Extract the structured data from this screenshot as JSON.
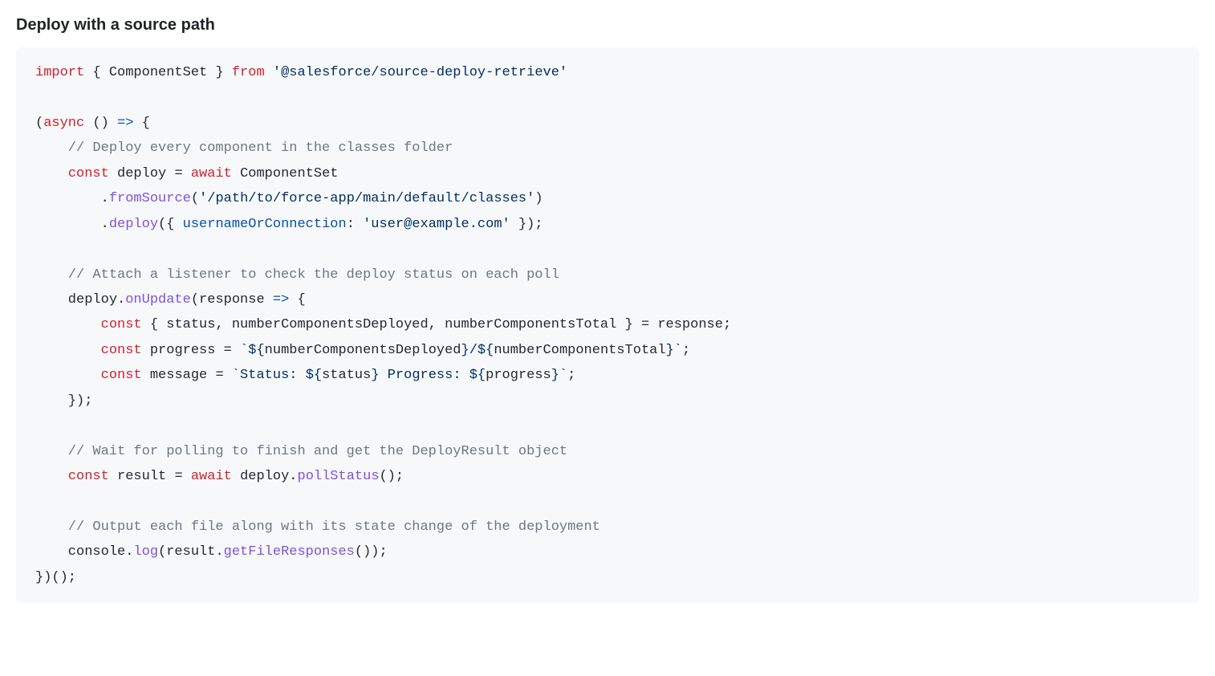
{
  "heading": "Deploy with a source path",
  "code": {
    "l1": {
      "import": "import",
      "left": " { ComponentSet } ",
      "from": "from",
      "str": " '@salesforce/source-deploy-retrieve'"
    },
    "l3": {
      "open": "(",
      "async": "async",
      "rest": " () ",
      "arrow": "=>",
      "brace": " {"
    },
    "l4": {
      "comment": "    // Deploy every component in the classes folder"
    },
    "l5": {
      "indent": "    ",
      "const": "const",
      "mid": " deploy = ",
      "await": "await",
      "rest": " ComponentSet"
    },
    "l6": {
      "indent": "        .",
      "method": "fromSource",
      "open": "(",
      "str": "'/path/to/force-app/main/default/classes'",
      "close": ")"
    },
    "l7": {
      "indent": "        .",
      "method": "deploy",
      "open": "({ ",
      "prop": "usernameOrConnection",
      "colon": ": ",
      "str": "'user@example.com'",
      "close": " });"
    },
    "l9": {
      "comment": "    // Attach a listener to check the deploy status on each poll"
    },
    "l10": {
      "indent": "    deploy.",
      "method": "onUpdate",
      "open": "(response ",
      "arrow": "=>",
      "close": " {"
    },
    "l11": {
      "indent": "        ",
      "const": "const",
      "rest": " { status, numberComponentsDeployed, numberComponentsTotal } = response;"
    },
    "l12": {
      "indent": "        ",
      "const": "const",
      "mid": " progress = ",
      "t1": "`",
      "e1o": "${",
      "e1": "numberComponentsDeployed",
      "e1c": "}",
      "slash": "/",
      "e2o": "${",
      "e2": "numberComponentsTotal",
      "e2c": "}",
      "t2": "`",
      "semi": ";"
    },
    "l13": {
      "indent": "        ",
      "const": "const",
      "mid": " message = ",
      "t1": "`Status: ",
      "e1o": "${",
      "e1": "status",
      "e1c": "}",
      "t2": " Progress: ",
      "e2o": "${",
      "e2": "progress",
      "e2c": "}",
      "t3": "`",
      "semi": ";"
    },
    "l14": {
      "text": "    });"
    },
    "l16": {
      "comment": "    // Wait for polling to finish and get the DeployResult object"
    },
    "l17": {
      "indent": "    ",
      "const": "const",
      "mid": " result = ",
      "await": "await",
      "mid2": " deploy.",
      "method": "pollStatus",
      "close": "();"
    },
    "l19": {
      "comment": "    // Output each file along with its state change of the deployment"
    },
    "l20": {
      "indent": "    console.",
      "method1": "log",
      "open": "(result.",
      "method2": "getFileResponses",
      "close": "());"
    },
    "l21": {
      "text": "})();"
    }
  }
}
